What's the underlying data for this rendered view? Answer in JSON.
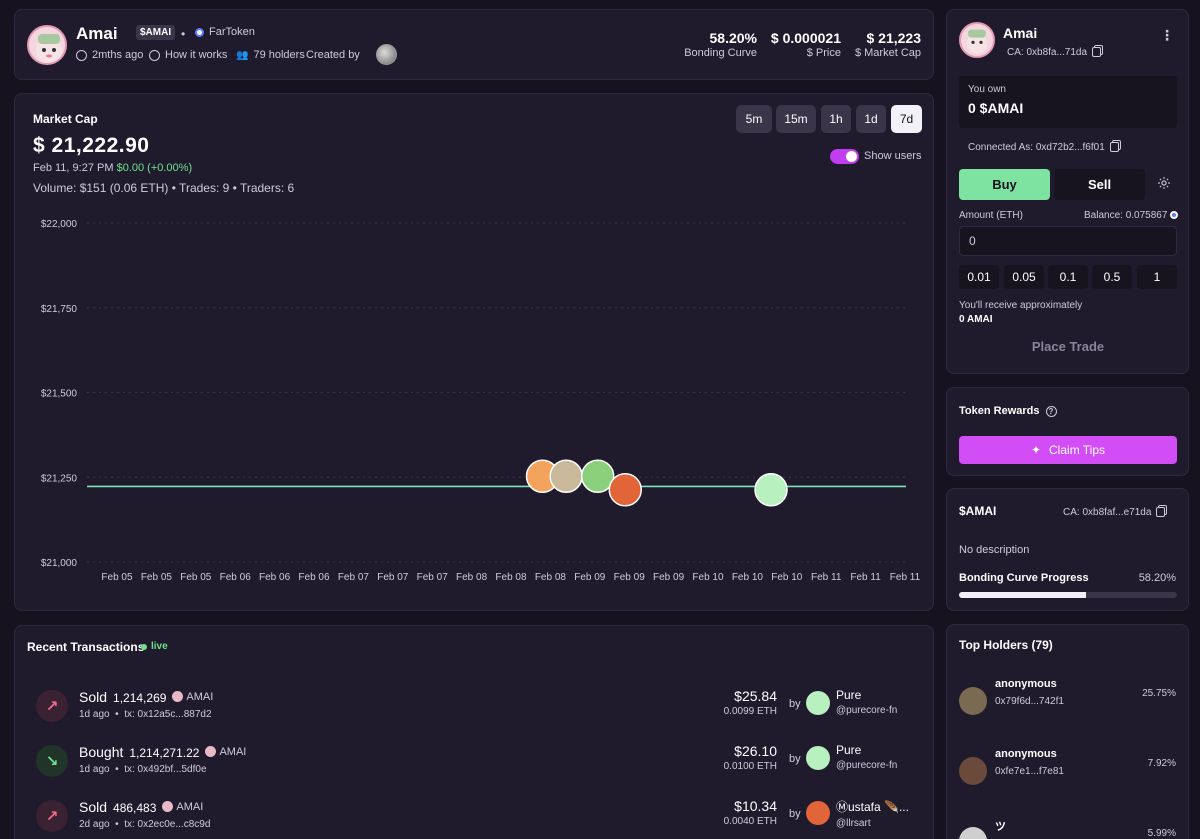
{
  "header": {
    "name": "Amai",
    "ticker": "$AMAI",
    "platform": "FarToken",
    "age": "2mths ago",
    "how_it_works": "How it works",
    "holders": "79 holders",
    "created_by": "Created by",
    "stats": [
      {
        "value": "58.20%",
        "label": "Bonding Curve"
      },
      {
        "value": "$ 0.000021",
        "label": "$  Price"
      },
      {
        "value": "$ 21,223",
        "label": "$  Market Cap"
      }
    ]
  },
  "chart_panel": {
    "title": "Market Cap",
    "value": "$ 21,222.90",
    "date": "Feb 11, 9:27 PM",
    "change": "$0.00 (+0.00%)",
    "volume_line": "Volume: $151 (0.06 ETH) • Trades: 9 • Traders: 6",
    "timeframes": [
      "5m",
      "15m",
      "1h",
      "1d",
      "7d"
    ],
    "active_timeframe": "7d",
    "show_users_label": "Show users"
  },
  "chart_data": {
    "type": "line",
    "y_ticks": [
      "$22,000",
      "$21,750",
      "$21,500",
      "$21,250",
      "$21,000"
    ],
    "ylim": [
      21000,
      22000
    ],
    "x_ticks": [
      "Feb 05",
      "Feb 05",
      "Feb 05",
      "Feb 06",
      "Feb 06",
      "Feb 06",
      "Feb 07",
      "Feb 07",
      "Feb 07",
      "Feb 08",
      "Feb 08",
      "Feb 08",
      "Feb 09",
      "Feb 09",
      "Feb 09",
      "Feb 10",
      "Feb 10",
      "Feb 10",
      "Feb 11",
      "Feb 11",
      "Feb 11"
    ],
    "series": [
      {
        "values": [
          21223,
          21223,
          21223,
          21223,
          21223,
          21223,
          21223,
          21223,
          21223,
          21223,
          21223,
          21223,
          21253,
          21223,
          21223,
          21223,
          21223,
          21223,
          21223,
          21223,
          21223
        ]
      }
    ],
    "line_color": "#7ee2b8",
    "user_markers": [
      {
        "x_index": 10.8,
        "value": 21253,
        "color": "#f3a35c"
      },
      {
        "x_index": 11.4,
        "value": 21253,
        "color": "#c9b89a"
      },
      {
        "x_index": 12.2,
        "value": 21253,
        "color": "#8ad07a"
      },
      {
        "x_index": 12.9,
        "value": 21213,
        "color": "#e2653a"
      },
      {
        "x_index": 16.6,
        "value": 21213,
        "color": "#b9f0c0"
      }
    ]
  },
  "transactions": {
    "title": "Recent Transactions",
    "live": "live",
    "by": "by",
    "rows": [
      {
        "type": "Sold",
        "amount": "1,214,269",
        "token": "AMAI",
        "age": "1d ago",
        "tx": "tx: 0x12a5c...887d2",
        "usd": "$25.84",
        "eth": "0.0099 ETH",
        "user": "Pure",
        "handle": "@purecore-fn",
        "avatar_color": "#b9f0c0"
      },
      {
        "type": "Bought",
        "amount": "1,214,271.22",
        "token": "AMAI",
        "age": "1d ago",
        "tx": "tx: 0x492bf...5df0e",
        "usd": "$26.10",
        "eth": "0.0100 ETH",
        "user": "Pure",
        "handle": "@purecore-fn",
        "avatar_color": "#b9f0c0"
      },
      {
        "type": "Sold",
        "amount": "486,483",
        "token": "AMAI",
        "age": "2d ago",
        "tx": "tx: 0x2ec0e...c8c9d",
        "usd": "$10.34",
        "eth": "0.0040 ETH",
        "user": "Ⓜustafa 🪶...",
        "handle": "@llrsart",
        "avatar_color": "#e2653a"
      }
    ]
  },
  "trade": {
    "name": "Amai",
    "ca": "CA: 0xb8fa...71da",
    "you_own_label": "You own",
    "you_own_value": "0 $AMAI",
    "connected": "Connected As: 0xd72b2...f6f01",
    "buy": "Buy",
    "sell": "Sell",
    "amount_label": "Amount (ETH)",
    "balance": "Balance: 0.075867",
    "amount_value": "0",
    "presets": [
      "0.01",
      "0.05",
      "0.1",
      "0.5",
      "1"
    ],
    "receive_label": "You'll receive approximately",
    "receive_value": "0 AMAI",
    "place": "Place Trade"
  },
  "rewards": {
    "title": "Token Rewards",
    "claim": "Claim Tips"
  },
  "token_info": {
    "title": "$AMAI",
    "ca": "CA: 0xb8faf...e71da",
    "description": "No description",
    "progress_label": "Bonding Curve Progress",
    "progress_value": "58.20%",
    "progress": 0.582
  },
  "holders": {
    "title": "Top Holders (79)",
    "rows": [
      {
        "name": "anonymous",
        "address": "0x79f6d...742f1",
        "pct": "25.75%",
        "avatar_color": "#7a6a52"
      },
      {
        "name": "anonymous",
        "address": "0xfe7e1...f7e81",
        "pct": "7.92%",
        "avatar_color": "#6a4a3a"
      },
      {
        "name": "ツ",
        "address": "",
        "pct": "5.99%",
        "avatar_color": "#cfcfcf"
      }
    ]
  }
}
